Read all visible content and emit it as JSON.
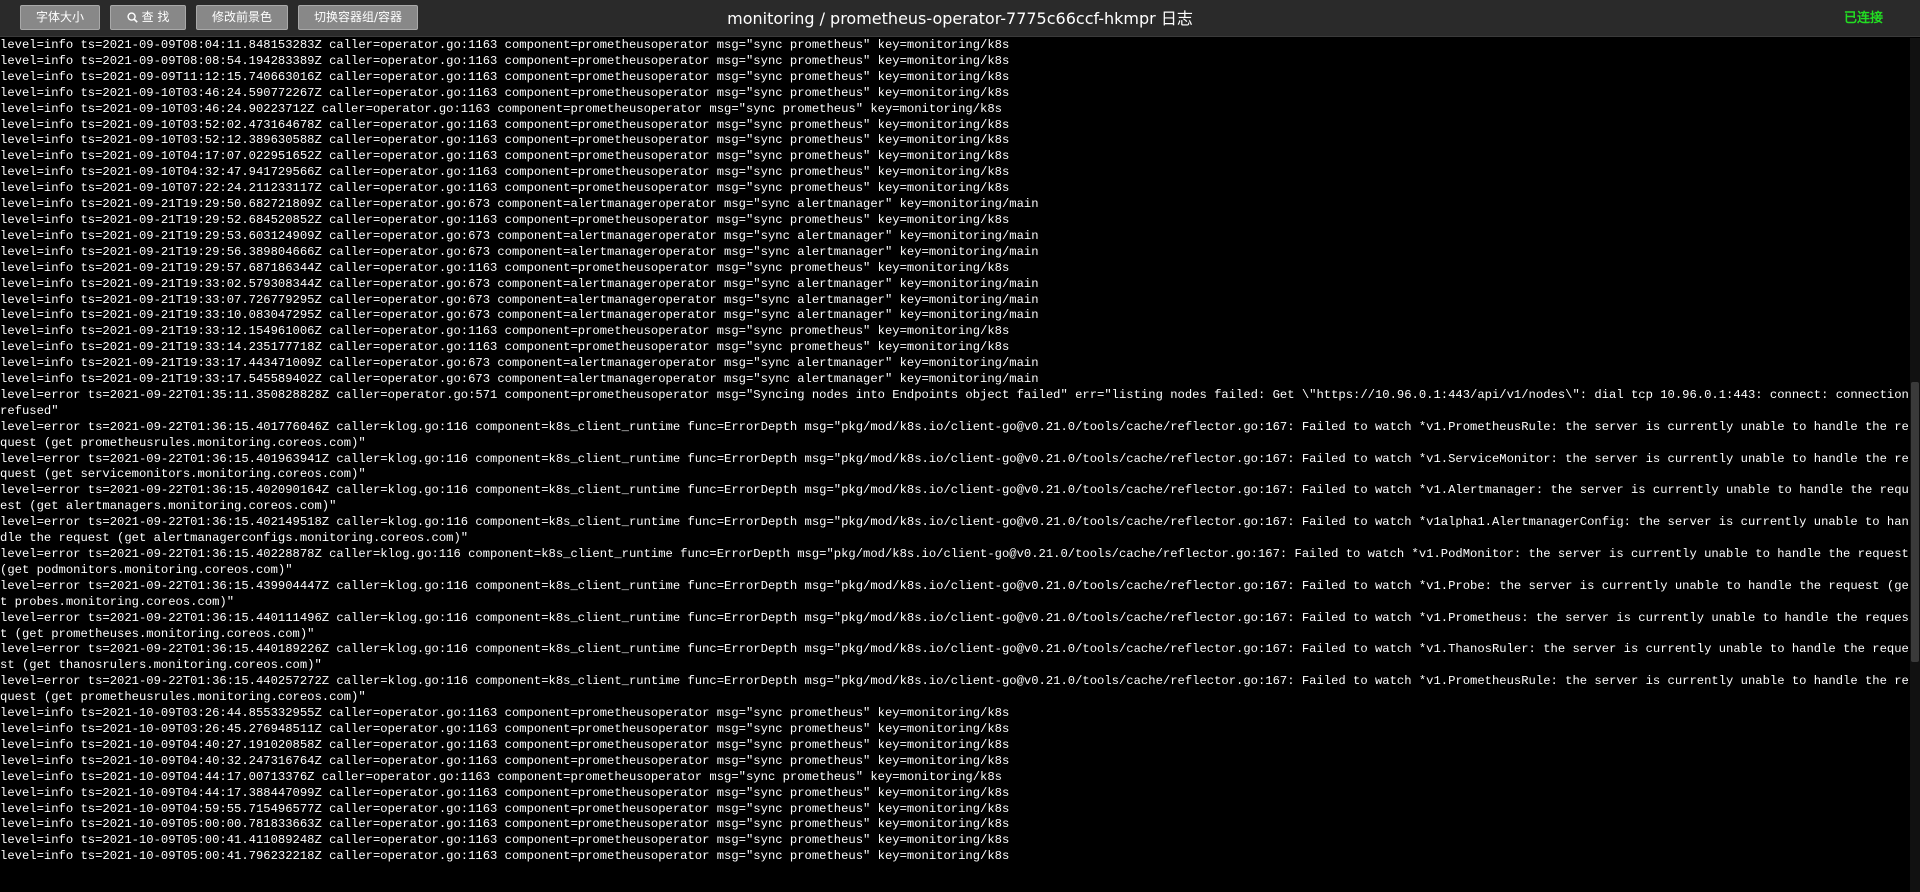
{
  "toolbar": {
    "font_size_label": "字体大小",
    "search_label": "查 找",
    "color_label": "修改前景色",
    "switch_label": "切换容器组/容器",
    "title": "monitoring / prometheus-operator-7775c66ccf-hkmpr 日志",
    "status": "已连接",
    "status_color": "#22dd22"
  },
  "scrollbar": {
    "position_fraction": 0.6
  },
  "log_lines": [
    "level=info ts=2021-09-09T08:04:11.848153283Z caller=operator.go:1163 component=prometheusoperator msg=\"sync prometheus\" key=monitoring/k8s",
    "level=info ts=2021-09-09T08:08:54.194283389Z caller=operator.go:1163 component=prometheusoperator msg=\"sync prometheus\" key=monitoring/k8s",
    "level=info ts=2021-09-09T11:12:15.740663016Z caller=operator.go:1163 component=prometheusoperator msg=\"sync prometheus\" key=monitoring/k8s",
    "level=info ts=2021-09-10T03:46:24.590772267Z caller=operator.go:1163 component=prometheusoperator msg=\"sync prometheus\" key=monitoring/k8s",
    "level=info ts=2021-09-10T03:46:24.90223712Z caller=operator.go:1163 component=prometheusoperator msg=\"sync prometheus\" key=monitoring/k8s",
    "level=info ts=2021-09-10T03:52:02.473164678Z caller=operator.go:1163 component=prometheusoperator msg=\"sync prometheus\" key=monitoring/k8s",
    "level=info ts=2021-09-10T03:52:12.389630588Z caller=operator.go:1163 component=prometheusoperator msg=\"sync prometheus\" key=monitoring/k8s",
    "level=info ts=2021-09-10T04:17:07.022951652Z caller=operator.go:1163 component=prometheusoperator msg=\"sync prometheus\" key=monitoring/k8s",
    "level=info ts=2021-09-10T04:32:47.941729566Z caller=operator.go:1163 component=prometheusoperator msg=\"sync prometheus\" key=monitoring/k8s",
    "level=info ts=2021-09-10T07:22:24.211233117Z caller=operator.go:1163 component=prometheusoperator msg=\"sync prometheus\" key=monitoring/k8s",
    "level=info ts=2021-09-21T19:29:50.682721809Z caller=operator.go:673 component=alertmanageroperator msg=\"sync alertmanager\" key=monitoring/main",
    "level=info ts=2021-09-21T19:29:52.684520852Z caller=operator.go:1163 component=prometheusoperator msg=\"sync prometheus\" key=monitoring/k8s",
    "level=info ts=2021-09-21T19:29:53.603124909Z caller=operator.go:673 component=alertmanageroperator msg=\"sync alertmanager\" key=monitoring/main",
    "level=info ts=2021-09-21T19:29:56.389804666Z caller=operator.go:673 component=alertmanageroperator msg=\"sync alertmanager\" key=monitoring/main",
    "level=info ts=2021-09-21T19:29:57.687186344Z caller=operator.go:1163 component=prometheusoperator msg=\"sync prometheus\" key=monitoring/k8s",
    "level=info ts=2021-09-21T19:33:02.579308344Z caller=operator.go:673 component=alertmanageroperator msg=\"sync alertmanager\" key=monitoring/main",
    "level=info ts=2021-09-21T19:33:07.726779295Z caller=operator.go:673 component=alertmanageroperator msg=\"sync alertmanager\" key=monitoring/main",
    "level=info ts=2021-09-21T19:33:10.083047295Z caller=operator.go:673 component=alertmanageroperator msg=\"sync alertmanager\" key=monitoring/main",
    "level=info ts=2021-09-21T19:33:12.154961006Z caller=operator.go:1163 component=prometheusoperator msg=\"sync prometheus\" key=monitoring/k8s",
    "level=info ts=2021-09-21T19:33:14.235177718Z caller=operator.go:1163 component=prometheusoperator msg=\"sync prometheus\" key=monitoring/k8s",
    "level=info ts=2021-09-21T19:33:17.443471009Z caller=operator.go:673 component=alertmanageroperator msg=\"sync alertmanager\" key=monitoring/main",
    "level=info ts=2021-09-21T19:33:17.545589402Z caller=operator.go:673 component=alertmanageroperator msg=\"sync alertmanager\" key=monitoring/main",
    "level=error ts=2021-09-22T01:35:11.350828828Z caller=operator.go:571 component=prometheusoperator msg=\"Syncing nodes into Endpoints object failed\" err=\"listing nodes failed: Get \\\"https://10.96.0.1:443/api/v1/nodes\\\": dial tcp 10.96.0.1:443: connect: connection refused\"",
    "level=error ts=2021-09-22T01:36:15.401776046Z caller=klog.go:116 component=k8s_client_runtime func=ErrorDepth msg=\"pkg/mod/k8s.io/client-go@v0.21.0/tools/cache/reflector.go:167: Failed to watch *v1.PrometheusRule: the server is currently unable to handle the request (get prometheusrules.monitoring.coreos.com)\"",
    "level=error ts=2021-09-22T01:36:15.401963941Z caller=klog.go:116 component=k8s_client_runtime func=ErrorDepth msg=\"pkg/mod/k8s.io/client-go@v0.21.0/tools/cache/reflector.go:167: Failed to watch *v1.ServiceMonitor: the server is currently unable to handle the request (get servicemonitors.monitoring.coreos.com)\"",
    "level=error ts=2021-09-22T01:36:15.402090164Z caller=klog.go:116 component=k8s_client_runtime func=ErrorDepth msg=\"pkg/mod/k8s.io/client-go@v0.21.0/tools/cache/reflector.go:167: Failed to watch *v1.Alertmanager: the server is currently unable to handle the request (get alertmanagers.monitoring.coreos.com)\"",
    "level=error ts=2021-09-22T01:36:15.402149518Z caller=klog.go:116 component=k8s_client_runtime func=ErrorDepth msg=\"pkg/mod/k8s.io/client-go@v0.21.0/tools/cache/reflector.go:167: Failed to watch *v1alpha1.AlertmanagerConfig: the server is currently unable to handle the request (get alertmanagerconfigs.monitoring.coreos.com)\"",
    "level=error ts=2021-09-22T01:36:15.40228878Z caller=klog.go:116 component=k8s_client_runtime func=ErrorDepth msg=\"pkg/mod/k8s.io/client-go@v0.21.0/tools/cache/reflector.go:167: Failed to watch *v1.PodMonitor: the server is currently unable to handle the request (get podmonitors.monitoring.coreos.com)\"",
    "level=error ts=2021-09-22T01:36:15.439904447Z caller=klog.go:116 component=k8s_client_runtime func=ErrorDepth msg=\"pkg/mod/k8s.io/client-go@v0.21.0/tools/cache/reflector.go:167: Failed to watch *v1.Probe: the server is currently unable to handle the request (get probes.monitoring.coreos.com)\"",
    "level=error ts=2021-09-22T01:36:15.440111496Z caller=klog.go:116 component=k8s_client_runtime func=ErrorDepth msg=\"pkg/mod/k8s.io/client-go@v0.21.0/tools/cache/reflector.go:167: Failed to watch *v1.Prometheus: the server is currently unable to handle the request (get prometheuses.monitoring.coreos.com)\"",
    "level=error ts=2021-09-22T01:36:15.440189226Z caller=klog.go:116 component=k8s_client_runtime func=ErrorDepth msg=\"pkg/mod/k8s.io/client-go@v0.21.0/tools/cache/reflector.go:167: Failed to watch *v1.ThanosRuler: the server is currently unable to handle the request (get thanosrulers.monitoring.coreos.com)\"",
    "level=error ts=2021-09-22T01:36:15.440257272Z caller=klog.go:116 component=k8s_client_runtime func=ErrorDepth msg=\"pkg/mod/k8s.io/client-go@v0.21.0/tools/cache/reflector.go:167: Failed to watch *v1.PrometheusRule: the server is currently unable to handle the request (get prometheusrules.monitoring.coreos.com)\"",
    "level=info ts=2021-10-09T03:26:44.855332955Z caller=operator.go:1163 component=prometheusoperator msg=\"sync prometheus\" key=monitoring/k8s",
    "level=info ts=2021-10-09T03:26:45.276948511Z caller=operator.go:1163 component=prometheusoperator msg=\"sync prometheus\" key=monitoring/k8s",
    "level=info ts=2021-10-09T04:40:27.191020858Z caller=operator.go:1163 component=prometheusoperator msg=\"sync prometheus\" key=monitoring/k8s",
    "level=info ts=2021-10-09T04:40:32.247316764Z caller=operator.go:1163 component=prometheusoperator msg=\"sync prometheus\" key=monitoring/k8s",
    "level=info ts=2021-10-09T04:44:17.00713376Z caller=operator.go:1163 component=prometheusoperator msg=\"sync prometheus\" key=monitoring/k8s",
    "level=info ts=2021-10-09T04:44:17.388447099Z caller=operator.go:1163 component=prometheusoperator msg=\"sync prometheus\" key=monitoring/k8s",
    "level=info ts=2021-10-09T04:59:55.715496577Z caller=operator.go:1163 component=prometheusoperator msg=\"sync prometheus\" key=monitoring/k8s",
    "level=info ts=2021-10-09T05:00:00.781833663Z caller=operator.go:1163 component=prometheusoperator msg=\"sync prometheus\" key=monitoring/k8s",
    "level=info ts=2021-10-09T05:00:41.411089248Z caller=operator.go:1163 component=prometheusoperator msg=\"sync prometheus\" key=monitoring/k8s",
    "level=info ts=2021-10-09T05:00:41.796232218Z caller=operator.go:1163 component=prometheusoperator msg=\"sync prometheus\" key=monitoring/k8s"
  ]
}
